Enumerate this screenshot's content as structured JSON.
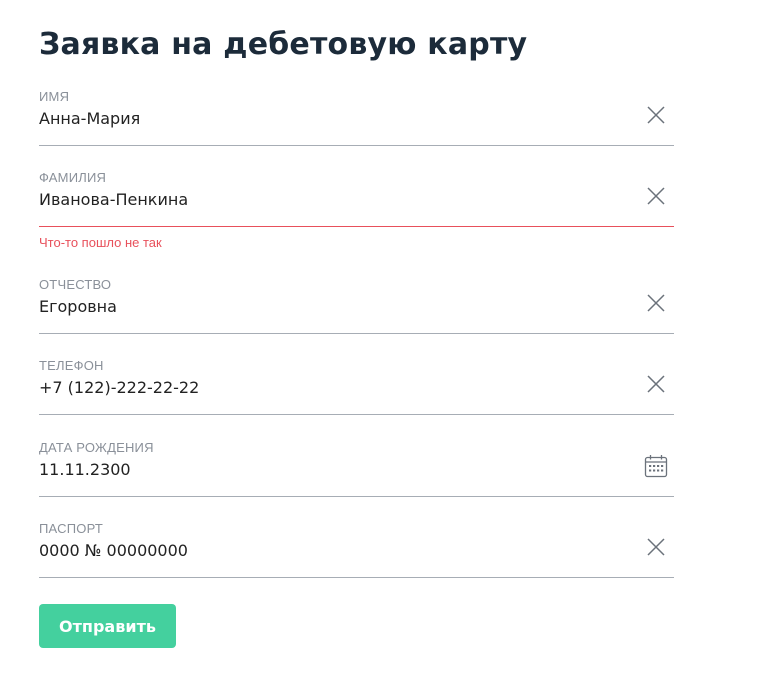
{
  "form": {
    "title": "Заявка на дебетовую карту",
    "fields": [
      {
        "label": "ИМЯ",
        "value": "Анна-Мария",
        "icon": "close-icon"
      },
      {
        "label": "ФАМИЛИЯ",
        "value": "Иванова-Пенкина",
        "icon": "close-icon",
        "error": "Что-то пошло не так"
      },
      {
        "label": "ОТЧЕСТВО",
        "value": "Егоровна",
        "icon": "close-icon"
      },
      {
        "label": "ТЕЛЕФОН",
        "value": "+7 (122)-222-22-22",
        "icon": "close-icon"
      },
      {
        "label": "ДАТА РОЖДЕНИЯ",
        "value": "11.11.2300",
        "icon": "calendar-icon"
      },
      {
        "label": "ПАСПОРТ",
        "value": "0000 № 00000000",
        "icon": "close-icon"
      }
    ],
    "submit_label": "Отправить"
  },
  "colors": {
    "accent": "#44d09e",
    "error": "#e8505b",
    "title": "#1c2b3a",
    "label": "#8a9099",
    "underline": "#a7adb5"
  }
}
